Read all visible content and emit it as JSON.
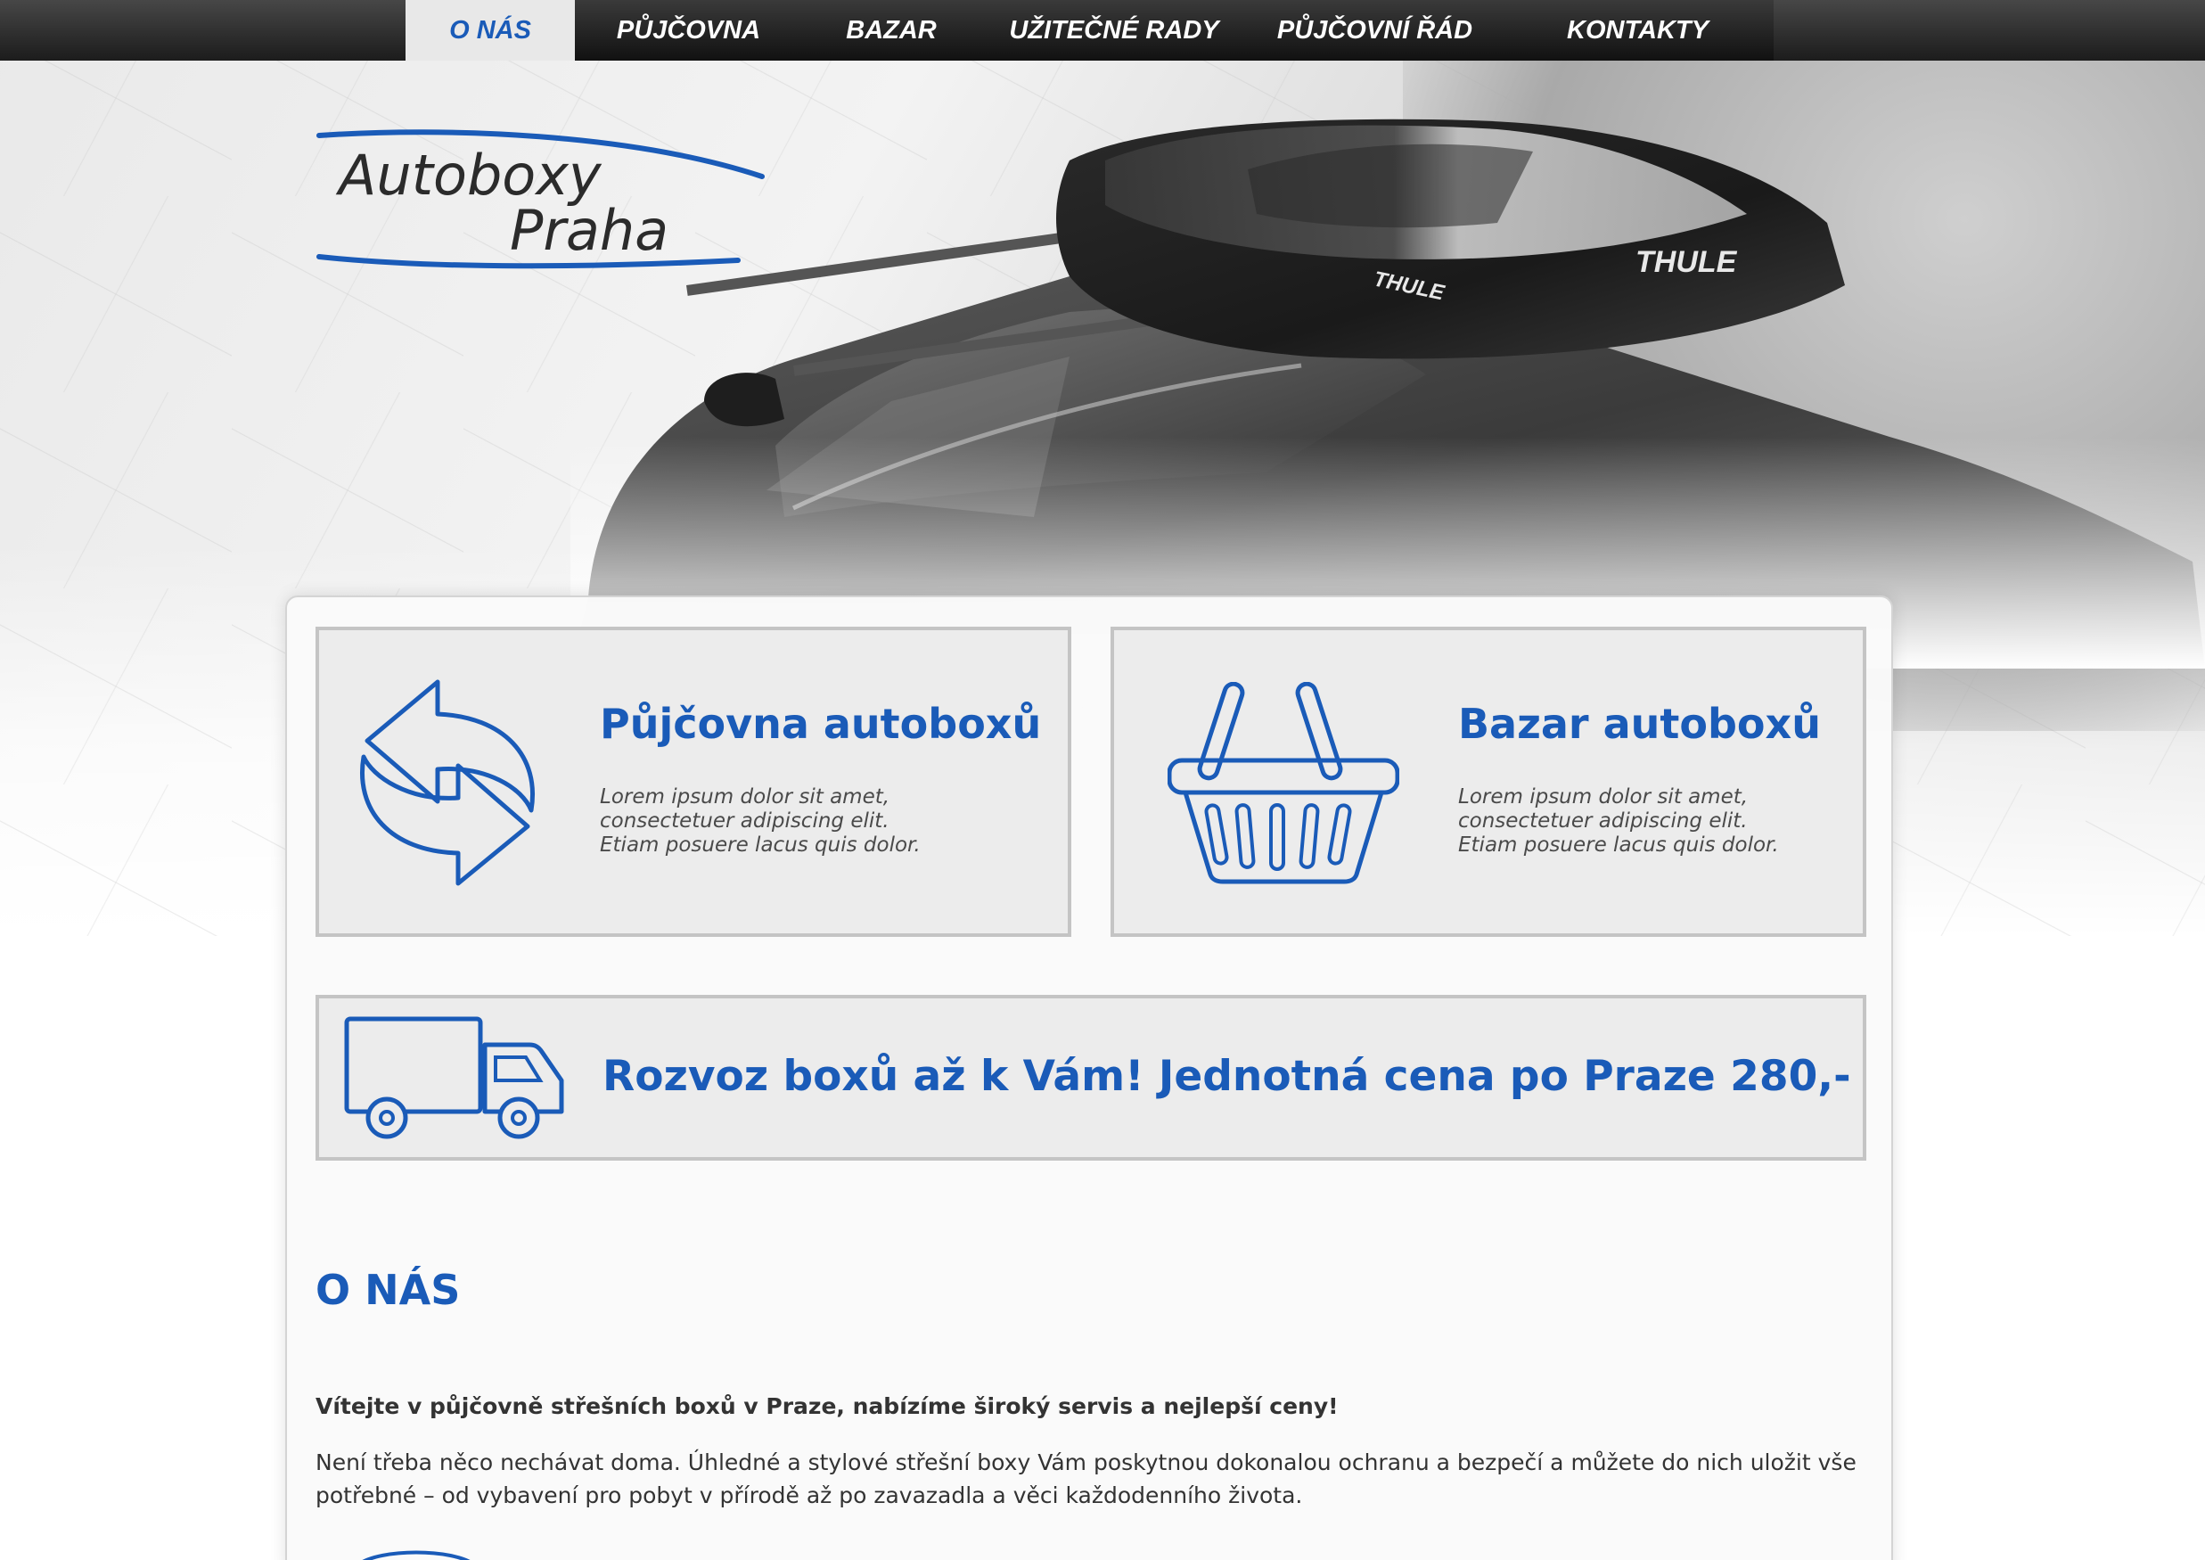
{
  "nav": {
    "items": [
      {
        "label": "O NÁS",
        "active": true
      },
      {
        "label": "PŮJČOVNA",
        "active": false
      },
      {
        "label": "BAZAR",
        "active": false
      },
      {
        "label": "UŽITEČNÉ RADY",
        "active": false
      },
      {
        "label": "PŮJČOVNÍ ŘÁD",
        "active": false
      },
      {
        "label": "KONTAKTY",
        "active": false
      }
    ]
  },
  "logo": {
    "line1": "Autoboxy",
    "line2": "Praha"
  },
  "hero": {
    "brand_text_1": "THULE",
    "brand_text_2": "THULE"
  },
  "boxes": {
    "rent": {
      "title": "Půjčovna autoboxů",
      "text_line1": "Lorem ipsum dolor sit amet,",
      "text_line2": "consectetuer adipiscing elit.",
      "text_line3": "Etiam posuere lacus quis dolor."
    },
    "bazar": {
      "title": "Bazar autoboxů",
      "text_line1": "Lorem ipsum dolor sit amet,",
      "text_line2": "consectetuer adipiscing elit.",
      "text_line3": "Etiam posuere lacus quis dolor."
    },
    "delivery": {
      "title": "Rozvoz boxů až k Vám! Jednotná cena po Praze 280,-"
    }
  },
  "about": {
    "heading": "O NÁS",
    "lead": "Vítejte v půjčovně střešních boxů v Praze, nabízíme široký servis a nejlepší ceny!",
    "text": "Není třeba něco nechávat doma. Úhledné a stylové střešní boxy Vám poskytnou dokonalou ochranu a bezpečí a můžete do nich uložit vše potřebné – od vybavení pro pobyt v přírodě až po zavazadla a věci každodenního života."
  },
  "colors": {
    "accent": "#1a5bb8",
    "nav_bg": "#1c1c1c",
    "box_bg": "#ececec",
    "box_border": "#c4c4c4"
  },
  "icons": {
    "rent": "exchange-arrows-icon",
    "bazar": "shopping-basket-icon",
    "delivery": "delivery-truck-icon"
  }
}
